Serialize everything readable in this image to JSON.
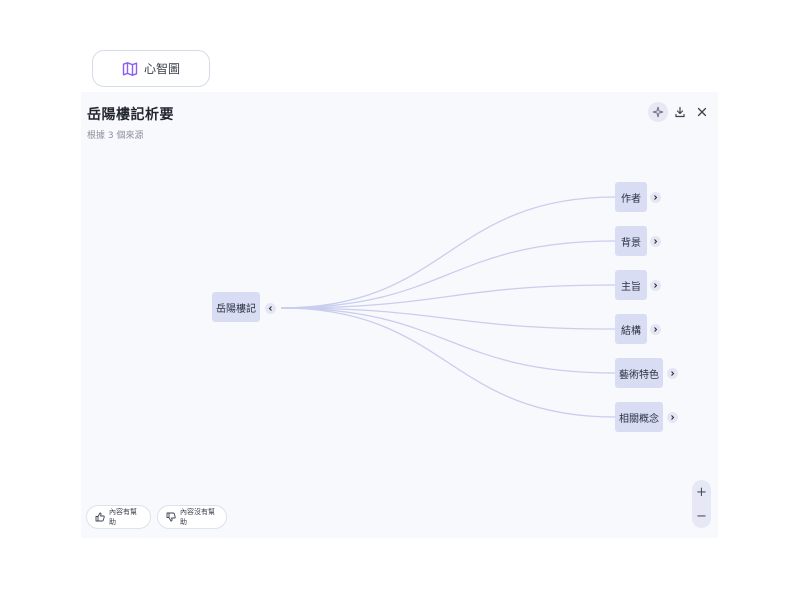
{
  "chip": {
    "icon": "map-icon",
    "label": "心智圖"
  },
  "panel": {
    "title": "岳陽樓記析要",
    "subtitle": "根據 3 個來源",
    "toolbar": {
      "sparkle_icon": "sparkle-icon",
      "download_icon": "download-icon",
      "close_icon": "close-icon"
    }
  },
  "mindmap": {
    "root": {
      "label": "岳陽樓記",
      "expander_icon": "chevron-left-icon"
    },
    "children": [
      {
        "label": "作者"
      },
      {
        "label": "背景"
      },
      {
        "label": "主旨"
      },
      {
        "label": "結構"
      },
      {
        "label": "藝術特色"
      },
      {
        "label": "相關概念"
      }
    ],
    "child_expander_icon": "chevron-right-icon",
    "colors": {
      "node_bg": "#d9ddf4",
      "connector": "#c9cdee",
      "accent": "#8b5cf6"
    }
  },
  "feedback": {
    "helpful_label": "內容有幫助",
    "helpful_icon": "thumbs-up-icon",
    "not_helpful_label": "內容沒有幫助",
    "not_helpful_icon": "thumbs-down-icon"
  },
  "zoom": {
    "in_label": "+",
    "out_label": "−"
  }
}
